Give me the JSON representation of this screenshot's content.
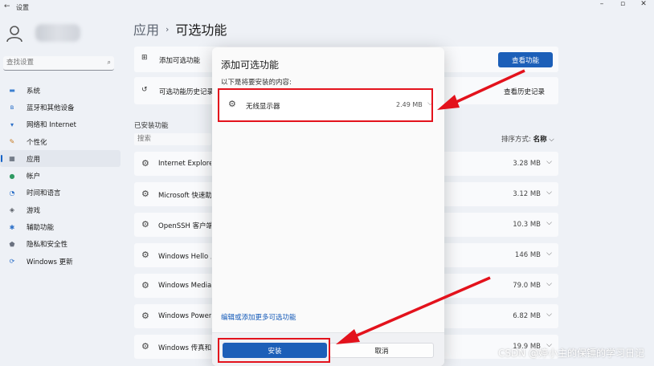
{
  "window": {
    "back_glyph": "←",
    "title": "设置",
    "controls": [
      "–",
      "▫",
      "✕"
    ]
  },
  "sidebar": {
    "search_placeholder": "查找设置",
    "items": [
      {
        "label": "系统",
        "icon": "monitor-icon",
        "glyph": "▬",
        "color": "#3c7fd0"
      },
      {
        "label": "蓝牙和其他设备",
        "icon": "bluetooth-icon",
        "glyph": "ʙ",
        "color": "#2b6fc8"
      },
      {
        "label": "网络和 Internet",
        "icon": "wifi-icon",
        "glyph": "▾",
        "color": "#2b6fc8"
      },
      {
        "label": "个性化",
        "icon": "brush-icon",
        "glyph": "✎",
        "color": "#c67a22"
      },
      {
        "label": "应用",
        "icon": "apps-icon",
        "glyph": "▦",
        "color": "#4b5563",
        "active": true
      },
      {
        "label": "帐户",
        "icon": "account-icon",
        "glyph": "●",
        "color": "#2f9a62"
      },
      {
        "label": "时间和语言",
        "icon": "clock-globe-icon",
        "glyph": "◔",
        "color": "#2b6fc8"
      },
      {
        "label": "游戏",
        "icon": "game-icon",
        "glyph": "◈",
        "color": "#555a62"
      },
      {
        "label": "辅助功能",
        "icon": "accessibility-icon",
        "glyph": "✱",
        "color": "#2b6fc8"
      },
      {
        "label": "隐私和安全性",
        "icon": "shield-icon",
        "glyph": "⬟",
        "color": "#6b7280"
      },
      {
        "label": "Windows 更新",
        "icon": "update-icon",
        "glyph": "⟳",
        "color": "#2b6fc8"
      }
    ]
  },
  "breadcrumb": {
    "parent": "应用",
    "separator": "›",
    "current": "可选功能"
  },
  "cards": {
    "add": {
      "label": "添加可选功能",
      "icon_glyph": "⊞",
      "button": "查看功能"
    },
    "history": {
      "label": "可选功能历史记录",
      "icon_glyph": "↺",
      "link": "查看历史记录"
    }
  },
  "installed": {
    "title": "已安装功能",
    "search_placeholder": "搜索",
    "sort_label": "排序方式:",
    "sort_value": "名称",
    "chevron": "⌵",
    "rows": [
      {
        "name": "Internet Explorer",
        "size": "3.28 MB"
      },
      {
        "name": "Microsoft 快速助手",
        "size": "3.12 MB"
      },
      {
        "name": "OpenSSH 客户端",
        "size": "10.3 MB"
      },
      {
        "name": "Windows Hello 人脸",
        "size": "146 MB"
      },
      {
        "name": "Windows Media Player",
        "size": "79.0 MB"
      },
      {
        "name": "Windows PowerShell",
        "size": "6.82 MB"
      },
      {
        "name": "Windows 传真和扫描",
        "size": "19.9 MB"
      }
    ]
  },
  "dialog": {
    "title": "添加可选功能",
    "subtitle": "以下是将要安装的内容:",
    "item": {
      "name": "无线显示器",
      "size": "2.49 MB"
    },
    "link": "编辑或添加更多可选功能",
    "install": "安装",
    "cancel": "取消"
  },
  "watermark": "CSDN @婷小主的保镖的学习日记",
  "colors": {
    "accent": "#1c5fb8",
    "annotation": "#e3121c",
    "background": "#eef1f6"
  }
}
